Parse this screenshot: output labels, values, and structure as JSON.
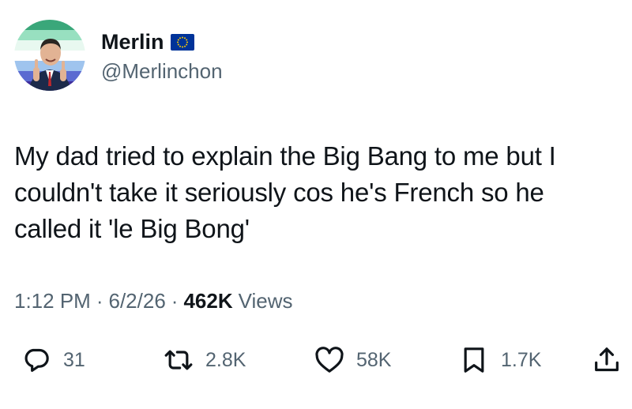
{
  "user": {
    "display_name": "Merlin",
    "badge_icon": "eu-flag-icon",
    "handle": "@Merlinchon"
  },
  "tweet": {
    "lines": [
      "My dad tried to explain the Big Bang to me but I",
      "couldn't take it seriously cos he's French so he",
      "called it 'le Big Bong'"
    ],
    "time": "1:12 PM",
    "date": "6/2/26",
    "views_count": "462K",
    "views_label": "Views"
  },
  "actions": {
    "replies": "31",
    "reposts": "2.8K",
    "likes": "58K",
    "bookmarks": "1.7K"
  },
  "colors": {
    "text": "#0f1419",
    "secondary": "#536471",
    "eu_blue": "#003399",
    "eu_star": "#ffcc00"
  }
}
